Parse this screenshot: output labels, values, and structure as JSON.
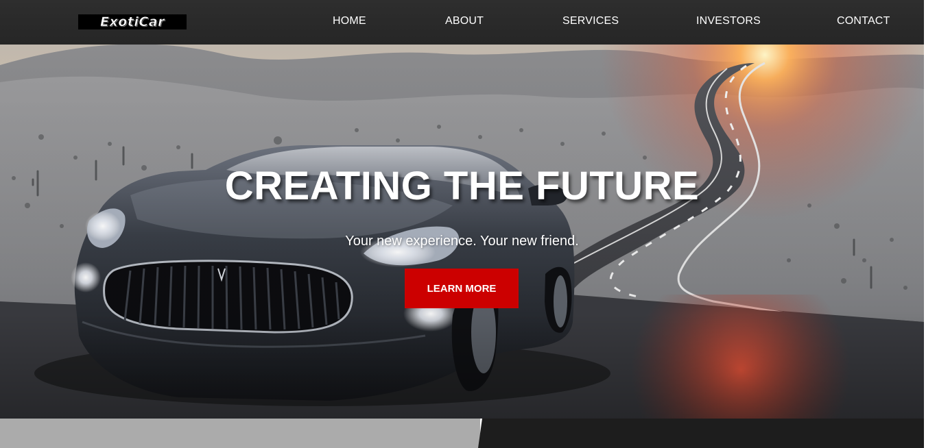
{
  "brand": {
    "logo_text": "ExotiCar",
    "accent_color": "#cc0000"
  },
  "nav": {
    "items": [
      {
        "label": "HOME"
      },
      {
        "label": "ABOUT"
      },
      {
        "label": "SERVICES"
      },
      {
        "label": "INVESTORS"
      },
      {
        "label": "CONTACT"
      }
    ]
  },
  "hero": {
    "title": "CREATING THE FUTURE",
    "subtitle": "Your new experience. Your new friend.",
    "cta_label": "LEARN MORE",
    "image_subject": "dark-grey-sports-car-on-desert-road-at-sunset"
  }
}
